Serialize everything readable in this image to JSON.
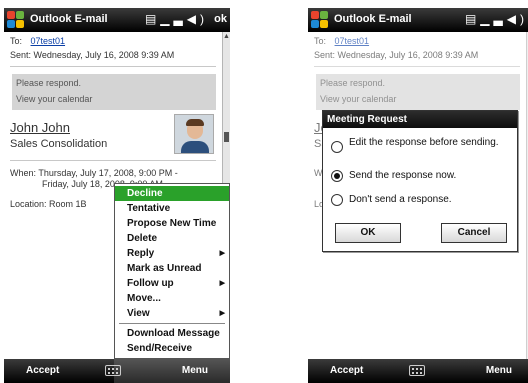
{
  "title_bar": {
    "title": "Outlook E-mail",
    "ok_label": "ok",
    "status_icons": [
      "contacts-icon",
      "signal-icon",
      "volume-icon"
    ]
  },
  "message": {
    "to_label": "To:",
    "to_value": "07test01",
    "sent_label": "Sent:",
    "sent_value": "Wednesday, July 16, 2008 9:39 AM",
    "notice_line1": "Please respond.",
    "notice_line2": "View your calendar",
    "sender": "John John",
    "subject": "Sales Consolidation",
    "when_line1": "When: Thursday, July 17, 2008, 9:00 PM -",
    "when_line2": "Friday, July 18, 2008, 9:00 AM",
    "location": "Location: Room 1B"
  },
  "menu": {
    "items": [
      "Decline",
      "Tentative",
      "Propose New Time",
      "Delete",
      "Reply",
      "Mark as Unread",
      "Follow up",
      "Move...",
      "View",
      "Download Message",
      "Send/Receive"
    ],
    "selected": "Decline"
  },
  "softkeys": {
    "left": "Accept",
    "right": "Menu"
  },
  "dialog": {
    "title": "Meeting Request",
    "option1": "Edit the response before sending.",
    "option2": "Send the response now.",
    "option3": "Don't send a response.",
    "selected_option": "Send the response now.",
    "ok": "OK",
    "cancel": "Cancel"
  },
  "colors": {
    "menu_highlight": "#2aa12a",
    "link": "#0b3fa6",
    "bar": "#000000"
  }
}
